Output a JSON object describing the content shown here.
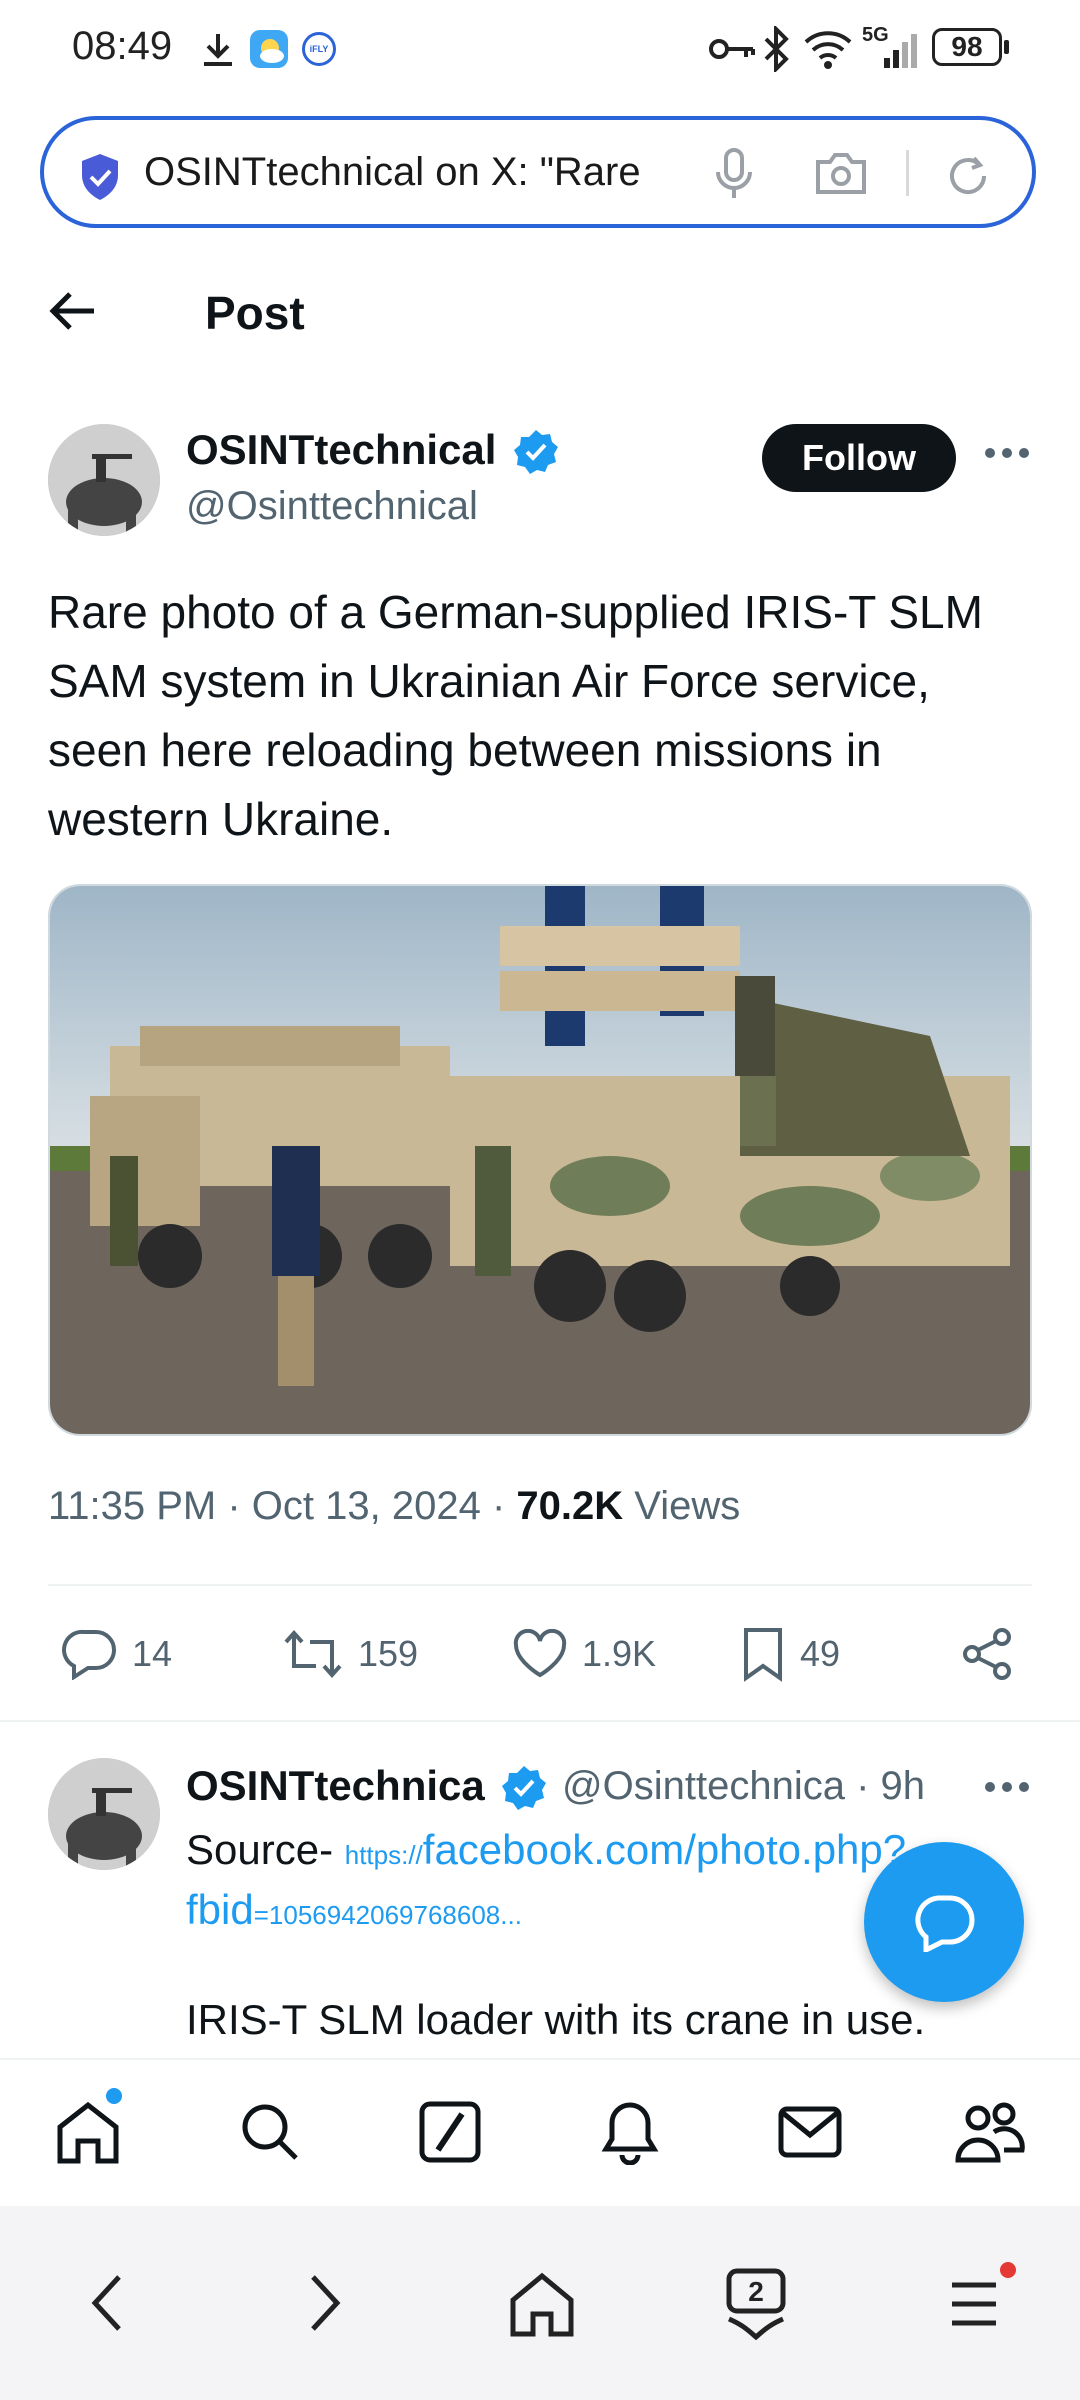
{
  "status": {
    "time": "08:49",
    "battery": "98",
    "network": "5G"
  },
  "urlbar": {
    "text": "OSINTtechnical on X: \"Rare"
  },
  "header": {
    "title": "Post"
  },
  "post": {
    "name": "OSINTtechnical",
    "handle": "@Osinttechnical",
    "follow_label": "Follow",
    "text": "Rare photo of a German-supplied IRIS-T SLM SAM system in Ukrainian Air Force service, seen here reloading between missions in western Ukraine.",
    "time": "11:35 PM · Oct 13, 2024 · ",
    "views_count": "70.2K",
    "views_label": " Views",
    "stats": {
      "replies": "14",
      "reposts": "159",
      "likes": "1.9K",
      "bookmarks": "49"
    }
  },
  "reply": {
    "name": "OSINTtechnica",
    "handle": "@Osinttechnica · 9h",
    "source_label": "Source- ",
    "link_scheme": "https://",
    "link_main": "facebook.com/photo.php?",
    "link_line2_main": "fbid",
    "link_line2_rest": "=1056942069768608...",
    "text": "IRIS-T SLM loader with its crane in use."
  },
  "colors": {
    "accent": "#1d9bf0",
    "url_border": "#2b63d9",
    "notification_dot": "#e53935"
  }
}
